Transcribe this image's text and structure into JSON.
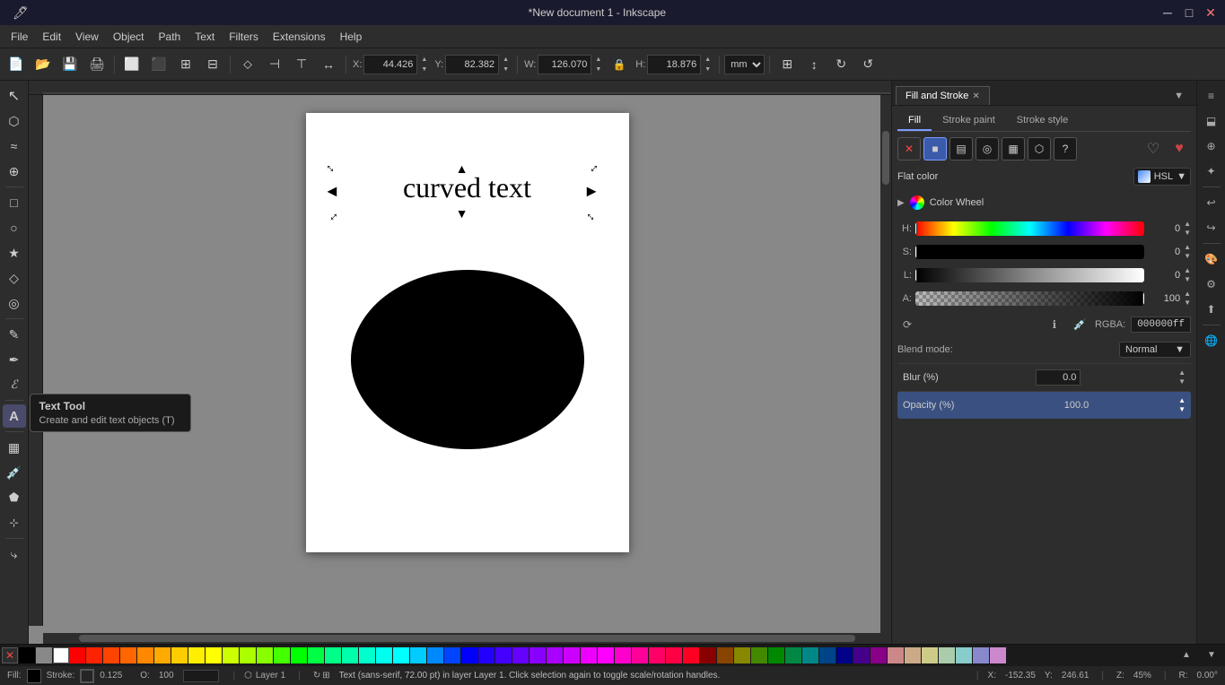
{
  "titlebar": {
    "title": "*New document 1 - Inkscape",
    "min": "─",
    "max": "□",
    "close": "✕"
  },
  "menubar": {
    "items": [
      "File",
      "Edit",
      "View",
      "Object",
      "Path",
      "Text",
      "Filters",
      "Extensions",
      "Help"
    ]
  },
  "toolbar": {
    "x_label": "X:",
    "x_value": "44.426",
    "y_label": "Y:",
    "y_value": "82.382",
    "w_label": "W:",
    "w_value": "126.070",
    "h_label": "H:",
    "h_value": "18.876",
    "unit": "mm"
  },
  "tools": [
    {
      "name": "select-tool",
      "icon": "↖",
      "active": false
    },
    {
      "name": "node-tool",
      "icon": "⬡",
      "active": false
    },
    {
      "name": "tweak-tool",
      "icon": "~",
      "active": false
    },
    {
      "name": "zoom-tool",
      "icon": "⊕",
      "active": false
    },
    {
      "name": "rect-tool",
      "icon": "□",
      "active": false
    },
    {
      "name": "ellipse-tool",
      "icon": "○",
      "active": false
    },
    {
      "name": "star-tool",
      "icon": "★",
      "active": false
    },
    {
      "name": "3d-box-tool",
      "icon": "◇",
      "active": false
    },
    {
      "name": "spiral-tool",
      "icon": "◎",
      "active": false
    },
    {
      "name": "pencil-tool",
      "icon": "✏",
      "active": false
    },
    {
      "name": "pen-tool",
      "icon": "✒",
      "active": false
    },
    {
      "name": "calligraphy-tool",
      "icon": "ℰ",
      "active": false
    },
    {
      "name": "text-tool",
      "icon": "A",
      "active": true,
      "tooltip_title": "Text Tool",
      "tooltip_desc": "Create and edit text objects (T)"
    },
    {
      "name": "gradient-tool",
      "icon": "▦",
      "active": false
    },
    {
      "name": "eyedropper-tool",
      "icon": "💉",
      "active": false
    },
    {
      "name": "paint-bucket-tool",
      "icon": "🪣",
      "active": false
    },
    {
      "name": "measure-tool",
      "icon": "📏",
      "active": false
    },
    {
      "name": "connector-tool",
      "icon": "⤷",
      "active": false
    }
  ],
  "canvas": {
    "curved_text": "curved text",
    "status_text": "Text (sans-serif, 72.00 pt) in layer Layer 1. Click selection again to toggle scale/rotation handles."
  },
  "fill_stroke": {
    "panel_title": "Fill and Stroke",
    "tabs": [
      "Fill",
      "Stroke paint",
      "Stroke style"
    ],
    "fill_buttons": [
      "✕",
      "□",
      "■",
      "▨",
      "⬡",
      "?"
    ],
    "flat_color_label": "Flat color",
    "color_mode": "HSL",
    "color_wheel_label": "Color Wheel",
    "h_label": "H:",
    "s_label": "S:",
    "l_label": "L:",
    "a_label": "A:",
    "h_value": "0",
    "s_value": "0",
    "l_value": "0",
    "a_value": "100",
    "rgba_label": "RGBA:",
    "rgba_value": "000000ff",
    "blend_label": "Blend mode:",
    "blend_value": "Normal",
    "blur_label": "Blur (%)",
    "blur_value": "0.0",
    "opacity_label": "Opacity (%)",
    "opacity_value": "100.0"
  },
  "statusbar": {
    "fill_label": "Fill:",
    "stroke_label": "Stroke:",
    "stroke_value": "0.125",
    "opacity_label": "O:",
    "opacity_value": "100",
    "layer": "Layer 1",
    "x_label": "X:",
    "x_value": "-152.35",
    "y_label": "Y:",
    "y_value": "246.61",
    "zoom_label": "Z:",
    "zoom_value": "45%",
    "rotation_label": "R:",
    "rotation_value": "0.00°"
  },
  "palette_colors": [
    "#000000",
    "#ffffff",
    "#808080",
    "#ff0000",
    "#ff8800",
    "#ffff00",
    "#00ff00",
    "#00ffff",
    "#0000ff",
    "#ff00ff",
    "#ff4444",
    "#ff8844",
    "#ffff44",
    "#44ff44",
    "#44ffff",
    "#4444ff",
    "#ff44ff",
    "#884444",
    "#884400",
    "#448800",
    "#004488",
    "#880088",
    "#440044",
    "#ff6666",
    "#ffaa66",
    "#ffffaa",
    "#aaffaa",
    "#aaffff",
    "#aaaaff",
    "#ffaaff",
    "#cc0000",
    "#cc6600",
    "#cccc00",
    "#00cc00",
    "#00cccc",
    "#0000cc",
    "#cc00cc",
    "#660000",
    "#663300",
    "#336600",
    "#003366",
    "#330066",
    "#ff9999",
    "#ffcc99",
    "#ffff99",
    "#99ff99",
    "#99ffff",
    "#9999ff",
    "#ff99ff"
  ]
}
